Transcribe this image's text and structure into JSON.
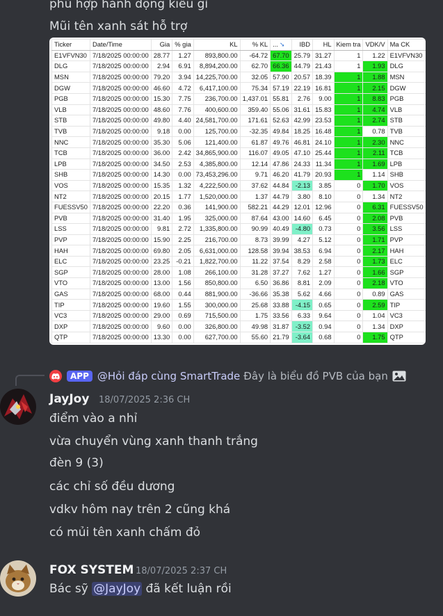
{
  "previous_message": {
    "lines": [
      "phù hợp hành động kiểu gì",
      "Mũi tên xanh sát hỗ trợ"
    ]
  },
  "table": {
    "headers": [
      "Ticker",
      "Date/Time",
      "Gia",
      "% gia",
      "KL",
      "% KL",
      "...",
      "IBD",
      "HL",
      "Kiem tra",
      "VDK/V",
      "Ma CK"
    ],
    "rows": [
      {
        "ticker": "E1VFVN30",
        "date": "7/18/2025 00:00:00",
        "gia": "28.77",
        "pct_gia": "1.27",
        "kl": "893,800.00",
        "pct_kl": "-64.72",
        "rs": "67.70",
        "ibd": "25.79",
        "hl": "31.27",
        "kiem_tra": "1",
        "vdkv": "1.22",
        "ma_ck": "E1VFVN30",
        "rs_hl": "green",
        "ibd_hl": "",
        "kt_hl": "",
        "vdkv_hl": ""
      },
      {
        "ticker": "DLG",
        "date": "7/18/2025 00:00:00",
        "gia": "2.94",
        "pct_gia": "6.91",
        "kl": "8,894,200.00",
        "pct_kl": "62.70",
        "rs": "66.36",
        "ibd": "44.79",
        "hl": "21.43",
        "kiem_tra": "1",
        "vdkv": "1.93",
        "ma_ck": "DLG",
        "rs_hl": "green",
        "ibd_hl": "",
        "kt_hl": "",
        "vdkv_hl": "green"
      },
      {
        "ticker": "MSN",
        "date": "7/18/2025 00:00:00",
        "gia": "79.20",
        "pct_gia": "3.94",
        "kl": "14,225,700.00",
        "pct_kl": "32.05",
        "rs": "57.90",
        "ibd": "20.57",
        "hl": "18.39",
        "kiem_tra": "1",
        "vdkv": "1.88",
        "ma_ck": "MSN",
        "rs_hl": "",
        "ibd_hl": "",
        "kt_hl": "green",
        "vdkv_hl": "green"
      },
      {
        "ticker": "DGW",
        "date": "7/18/2025 00:00:00",
        "gia": "46.60",
        "pct_gia": "4.72",
        "kl": "6,417,100.00",
        "pct_kl": "75.34",
        "rs": "57.19",
        "ibd": "22.19",
        "hl": "16.81",
        "kiem_tra": "1",
        "vdkv": "2.15",
        "ma_ck": "DGW",
        "rs_hl": "",
        "ibd_hl": "",
        "kt_hl": "green",
        "vdkv_hl": "green"
      },
      {
        "ticker": "PGB",
        "date": "7/18/2025 00:00:00",
        "gia": "15.30",
        "pct_gia": "7.75",
        "kl": "236,700.00",
        "pct_kl": "1,437.01",
        "rs": "55.81",
        "ibd": "2.76",
        "hl": "9.00",
        "kiem_tra": "1",
        "vdkv": "8.83",
        "ma_ck": "PGB",
        "rs_hl": "",
        "ibd_hl": "",
        "kt_hl": "green",
        "vdkv_hl": "green"
      },
      {
        "ticker": "VLB",
        "date": "7/18/2025 00:00:00",
        "gia": "48.60",
        "pct_gia": "7.76",
        "kl": "400,600.00",
        "pct_kl": "359.40",
        "rs": "55.06",
        "ibd": "31.61",
        "hl": "15.83",
        "kiem_tra": "1",
        "vdkv": "4.74",
        "ma_ck": "VLB",
        "rs_hl": "",
        "ibd_hl": "",
        "kt_hl": "green",
        "vdkv_hl": "green"
      },
      {
        "ticker": "STB",
        "date": "7/18/2025 00:00:00",
        "gia": "49.80",
        "pct_gia": "4.40",
        "kl": "24,581,700.00",
        "pct_kl": "171.61",
        "rs": "52.63",
        "ibd": "42.99",
        "hl": "23.53",
        "kiem_tra": "1",
        "vdkv": "2.74",
        "ma_ck": "STB",
        "rs_hl": "",
        "ibd_hl": "",
        "kt_hl": "green",
        "vdkv_hl": "green"
      },
      {
        "ticker": "TVB",
        "date": "7/18/2025 00:00:00",
        "gia": "9.18",
        "pct_gia": "0.00",
        "kl": "125,700.00",
        "pct_kl": "-32.35",
        "rs": "49.84",
        "ibd": "18.25",
        "hl": "16.48",
        "kiem_tra": "1",
        "vdkv": "0.78",
        "ma_ck": "TVB",
        "rs_hl": "",
        "ibd_hl": "",
        "kt_hl": "green",
        "vdkv_hl": ""
      },
      {
        "ticker": "NNC",
        "date": "7/18/2025 00:00:00",
        "gia": "35.30",
        "pct_gia": "5.06",
        "kl": "121,400.00",
        "pct_kl": "61.87",
        "rs": "49.76",
        "ibd": "46.81",
        "hl": "24.10",
        "kiem_tra": "1",
        "vdkv": "2.30",
        "ma_ck": "NNC",
        "rs_hl": "",
        "ibd_hl": "",
        "kt_hl": "green",
        "vdkv_hl": "green"
      },
      {
        "ticker": "TCB",
        "date": "7/18/2025 00:00:00",
        "gia": "36.00",
        "pct_gia": "2.42",
        "kl": "34,865,900.00",
        "pct_kl": "116.07",
        "rs": "49.05",
        "ibd": "47.10",
        "hl": "25.44",
        "kiem_tra": "1",
        "vdkv": "2.11",
        "ma_ck": "TCB",
        "rs_hl": "",
        "ibd_hl": "",
        "kt_hl": "green",
        "vdkv_hl": "green"
      },
      {
        "ticker": "LPB",
        "date": "7/18/2025 00:00:00",
        "gia": "34.50",
        "pct_gia": "2.53",
        "kl": "4,385,800.00",
        "pct_kl": "12.14",
        "rs": "47.86",
        "ibd": "24.33",
        "hl": "11.34",
        "kiem_tra": "1",
        "vdkv": "1.69",
        "ma_ck": "LPB",
        "rs_hl": "",
        "ibd_hl": "",
        "kt_hl": "green",
        "vdkv_hl": "green"
      },
      {
        "ticker": "SHB",
        "date": "7/18/2025 00:00:00",
        "gia": "14.30",
        "pct_gia": "0.00",
        "kl": "73,453,296.00",
        "pct_kl": "9.71",
        "rs": "46.20",
        "ibd": "41.79",
        "hl": "20.93",
        "kiem_tra": "1",
        "vdkv": "1.14",
        "ma_ck": "SHB",
        "rs_hl": "",
        "ibd_hl": "",
        "kt_hl": "green",
        "vdkv_hl": ""
      },
      {
        "ticker": "VOS",
        "date": "7/18/2025 00:00:00",
        "gia": "15.35",
        "pct_gia": "1.32",
        "kl": "4,222,500.00",
        "pct_kl": "37.62",
        "rs": "44.84",
        "ibd": "-2.13",
        "hl": "3.85",
        "kiem_tra": "0",
        "vdkv": "1.70",
        "ma_ck": "VOS",
        "rs_hl": "",
        "ibd_hl": "mint",
        "kt_hl": "",
        "vdkv_hl": "green"
      },
      {
        "ticker": "NT2",
        "date": "7/18/2025 00:00:00",
        "gia": "20.15",
        "pct_gia": "1.77",
        "kl": "1,520,000.00",
        "pct_kl": "1.37",
        "rs": "44.79",
        "ibd": "3.80",
        "hl": "8.10",
        "kiem_tra": "0",
        "vdkv": "1.34",
        "ma_ck": "NT2",
        "rs_hl": "",
        "ibd_hl": "",
        "kt_hl": "",
        "vdkv_hl": ""
      },
      {
        "ticker": "FUESSV50",
        "date": "7/18/2025 00:00:00",
        "gia": "22.20",
        "pct_gia": "0.36",
        "kl": "141,900.00",
        "pct_kl": "582.21",
        "rs": "44.29",
        "ibd": "12.01",
        "hl": "12.96",
        "kiem_tra": "0",
        "vdkv": "6.31",
        "ma_ck": "FUESSV50",
        "rs_hl": "",
        "ibd_hl": "",
        "kt_hl": "",
        "vdkv_hl": "green"
      },
      {
        "ticker": "PVB",
        "date": "7/18/2025 00:00:00",
        "gia": "31.40",
        "pct_gia": "1.95",
        "kl": "325,000.00",
        "pct_kl": "87.64",
        "rs": "43.00",
        "ibd": "14.60",
        "hl": "6.45",
        "kiem_tra": "0",
        "vdkv": "2.08",
        "ma_ck": "PVB",
        "rs_hl": "",
        "ibd_hl": "",
        "kt_hl": "",
        "vdkv_hl": "green"
      },
      {
        "ticker": "LSS",
        "date": "7/18/2025 00:00:00",
        "gia": "9.81",
        "pct_gia": "2.72",
        "kl": "1,335,800.00",
        "pct_kl": "90.99",
        "rs": "40.49",
        "ibd": "-4.80",
        "hl": "0.73",
        "kiem_tra": "0",
        "vdkv": "3.56",
        "ma_ck": "LSS",
        "rs_hl": "",
        "ibd_hl": "mint",
        "kt_hl": "",
        "vdkv_hl": "green"
      },
      {
        "ticker": "PVP",
        "date": "7/18/2025 00:00:00",
        "gia": "15.90",
        "pct_gia": "2.25",
        "kl": "216,700.00",
        "pct_kl": "8.73",
        "rs": "39.99",
        "ibd": "4.27",
        "hl": "5.12",
        "kiem_tra": "0",
        "vdkv": "1.71",
        "ma_ck": "PVP",
        "rs_hl": "",
        "ibd_hl": "",
        "kt_hl": "",
        "vdkv_hl": "green"
      },
      {
        "ticker": "HAH",
        "date": "7/18/2025 00:00:00",
        "gia": "69.80",
        "pct_gia": "2.05",
        "kl": "6,631,000.00",
        "pct_kl": "128.58",
        "rs": "39.94",
        "ibd": "38.53",
        "hl": "6.94",
        "kiem_tra": "0",
        "vdkv": "2.17",
        "ma_ck": "HAH",
        "rs_hl": "",
        "ibd_hl": "",
        "kt_hl": "",
        "vdkv_hl": "green"
      },
      {
        "ticker": "ELC",
        "date": "7/18/2025 00:00:00",
        "gia": "23.25",
        "pct_gia": "-0.21",
        "kl": "1,822,700.00",
        "pct_kl": "11.22",
        "rs": "37.54",
        "ibd": "8.29",
        "hl": "2.58",
        "kiem_tra": "0",
        "vdkv": "1.73",
        "ma_ck": "ELC",
        "rs_hl": "",
        "ibd_hl": "",
        "kt_hl": "",
        "vdkv_hl": "green"
      },
      {
        "ticker": "SGP",
        "date": "7/18/2025 00:00:00",
        "gia": "28.00",
        "pct_gia": "1.08",
        "kl": "266,100.00",
        "pct_kl": "31.28",
        "rs": "37.27",
        "ibd": "7.62",
        "hl": "1.27",
        "kiem_tra": "0",
        "vdkv": "1.66",
        "ma_ck": "SGP",
        "rs_hl": "",
        "ibd_hl": "",
        "kt_hl": "",
        "vdkv_hl": "green"
      },
      {
        "ticker": "VTO",
        "date": "7/18/2025 00:00:00",
        "gia": "13.00",
        "pct_gia": "1.56",
        "kl": "850,800.00",
        "pct_kl": "6.50",
        "rs": "36.86",
        "ibd": "8.81",
        "hl": "2.09",
        "kiem_tra": "0",
        "vdkv": "2.18",
        "ma_ck": "VTO",
        "rs_hl": "",
        "ibd_hl": "",
        "kt_hl": "",
        "vdkv_hl": "green"
      },
      {
        "ticker": "GAS",
        "date": "7/18/2025 00:00:00",
        "gia": "68.00",
        "pct_gia": "0.44",
        "kl": "881,900.00",
        "pct_kl": "-36.66",
        "rs": "35.38",
        "ibd": "5.62",
        "hl": "4.66",
        "kiem_tra": "0",
        "vdkv": "0.89",
        "ma_ck": "GAS",
        "rs_hl": "",
        "ibd_hl": "",
        "kt_hl": "",
        "vdkv_hl": ""
      },
      {
        "ticker": "TIP",
        "date": "7/18/2025 00:00:00",
        "gia": "19.60",
        "pct_gia": "1.55",
        "kl": "300,000.00",
        "pct_kl": "25.68",
        "rs": "33.88",
        "ibd": "-4.15",
        "hl": "0.65",
        "kiem_tra": "0",
        "vdkv": "2.59",
        "ma_ck": "TIP",
        "rs_hl": "",
        "ibd_hl": "mint",
        "kt_hl": "",
        "vdkv_hl": "green"
      },
      {
        "ticker": "VC3",
        "date": "7/18/2025 00:00:00",
        "gia": "29.00",
        "pct_gia": "0.69",
        "kl": "715,500.00",
        "pct_kl": "1.75",
        "rs": "33.56",
        "ibd": "6.33",
        "hl": "9.64",
        "kiem_tra": "0",
        "vdkv": "1.04",
        "ma_ck": "VC3",
        "rs_hl": "",
        "ibd_hl": "",
        "kt_hl": "",
        "vdkv_hl": ""
      },
      {
        "ticker": "DXP",
        "date": "7/18/2025 00:00:00",
        "gia": "9.60",
        "pct_gia": "0.00",
        "kl": "326,800.00",
        "pct_kl": "49.98",
        "rs": "31.87",
        "ibd": "-3.52",
        "hl": "0.94",
        "kiem_tra": "0",
        "vdkv": "1.34",
        "ma_ck": "DXP",
        "rs_hl": "",
        "ibd_hl": "mint",
        "kt_hl": "",
        "vdkv_hl": ""
      },
      {
        "ticker": "QTP",
        "date": "7/18/2025 00:00:00",
        "gia": "13.30",
        "pct_gia": "0.00",
        "kl": "627,700.00",
        "pct_kl": "55.60",
        "rs": "21.79",
        "ibd": "-3.64",
        "hl": "0.68",
        "kiem_tra": "0",
        "vdkv": "1.75",
        "ma_ck": "QTP",
        "rs_hl": "",
        "ibd_hl": "mint",
        "kt_hl": "",
        "vdkv_hl": "green"
      }
    ]
  },
  "reply": {
    "app_tag": "APP",
    "mention": "@Hỏi đáp cùng SmartTrade",
    "text": "Đây là biểu đồ PVB của bạn",
    "icons": [
      "discord-icon",
      "image-icon"
    ]
  },
  "messages": [
    {
      "author": "JayJoy",
      "timestamp": "18/07/2025 2:36 CH",
      "lines": [
        "điểm vào a nhỉ",
        "vừa chuyển vùng xanh thanh trắng",
        "đèn 9 (3)",
        "các chỉ số đều dương",
        "vdkv hôm nay trên 2 cũng khá",
        "có mủi tên xanh chấm đỏ"
      ]
    },
    {
      "author": "FOX SYSTEM",
      "timestamp": "18/07/2025 2:37 CH",
      "pre": "Bác sỹ",
      "mention": "@JayJoy",
      "post": "đã kết luận rồi"
    }
  ],
  "colors": {
    "background": "#313338",
    "highlight_green": "#1de11d",
    "highlight_mint": "#7ff0c8",
    "app_tag": "#5865f2",
    "mention_bg": "#3c4270"
  }
}
